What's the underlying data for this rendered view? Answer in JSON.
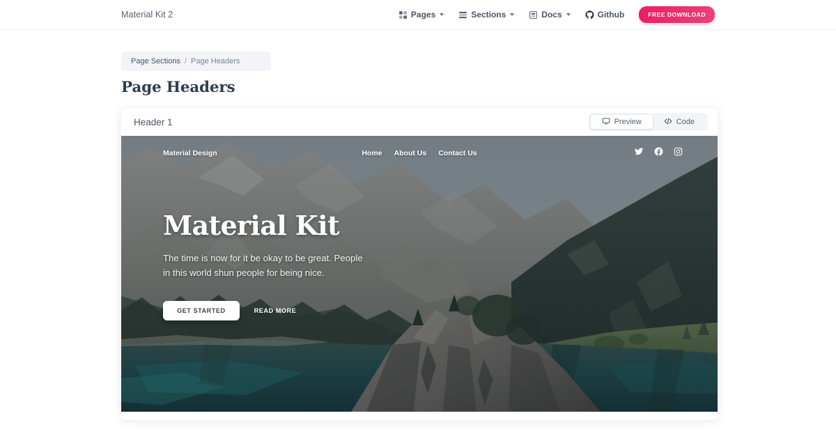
{
  "topnav": {
    "brand": "Material Kit 2",
    "items": [
      {
        "label": "Pages",
        "icon": "grid-icon",
        "caret": true
      },
      {
        "label": "Sections",
        "icon": "sections-icon",
        "caret": true
      },
      {
        "label": "Docs",
        "icon": "document-icon",
        "caret": true
      },
      {
        "label": "Github",
        "icon": "github-icon",
        "caret": false
      }
    ],
    "download_label": "FREE DOWNLOAD",
    "accent_color": "#e91e63"
  },
  "breadcrumb": {
    "parent": "Page Sections",
    "separator": "/",
    "current": "Page Headers"
  },
  "page": {
    "title": "Page Headers",
    "title_color": "#2d3e50"
  },
  "example": {
    "title": "Header 1",
    "toggle": {
      "preview_label": "Preview",
      "preview_icon": "monitor-icon",
      "code_label": "Code",
      "code_icon": "code-icon",
      "active": "Preview"
    }
  },
  "hero": {
    "brand": "Material Design",
    "links": [
      "Home",
      "About Us",
      "Contact Us"
    ],
    "social": [
      "twitter-icon",
      "facebook-icon",
      "instagram-icon"
    ],
    "heading": "Material Kit",
    "paragraph": "The time is now for it be okay to be great. People in this world shun people for being nice.",
    "primary_button": "GET STARTED",
    "secondary_button": "READ MORE"
  }
}
